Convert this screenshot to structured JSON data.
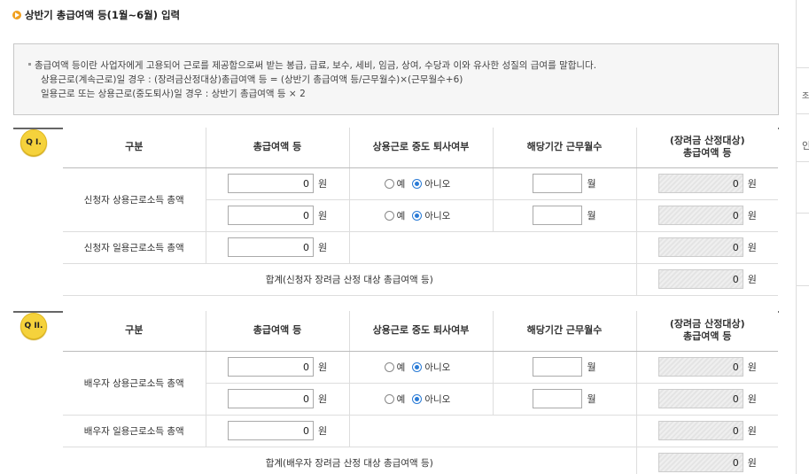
{
  "page": {
    "title": "상반기 총급여액 등(1월~6월) 입력"
  },
  "info": {
    "lines": [
      "총급여액 등이란 사업자에게 고용되어 근로를 제공함으로써 받는 봉급, 급료, 보수, 세비, 임금, 상여, 수당과 이와 유사한 성질의 급여를 말합니다.",
      "상용근로(계속근로)일 경우 : (장려금산정대상)총급여액 등 = (상반기 총급여액 등/근무월수)×(근무월수+6)",
      "일용근로 또는 상용근로(중도퇴사)일 경우 : 상반기 총급여액 등 × 2"
    ]
  },
  "columns": {
    "category": "구분",
    "total_pay": "총급여액 등",
    "resign": "상용근로 중도 퇴사여부",
    "months": "해당기간 근무월수",
    "calc_line1": "(장려금 산정대상)",
    "calc_line2": "총급여액 등"
  },
  "units": {
    "won": "원",
    "month": "월"
  },
  "radio": {
    "yes": "예",
    "no": "아니오"
  },
  "section1": {
    "badge": "Q I.",
    "regular_label": "신청자 상용근로소득 총액",
    "daily_label": "신청자 일용근로소득 총액",
    "sum_label": "합계(신청자 장려금 산정 대상 총급여액 등)",
    "row1": {
      "amount": "0",
      "calc": "0"
    },
    "row2": {
      "amount": "0",
      "calc": "0"
    },
    "daily": {
      "amount": "0",
      "calc": "0"
    },
    "sum": "0"
  },
  "section2": {
    "badge": "Q II.",
    "regular_label": "배우자 상용근로소득 총액",
    "daily_label": "배우자 일용근로소득 총액",
    "sum_label": "합계(배우자 장려금 산정 대상 총급여액 등)",
    "row1": {
      "amount": "0",
      "calc": "0"
    },
    "row2": {
      "amount": "0",
      "calc": "0"
    },
    "daily": {
      "amount": "0",
      "calc": "0"
    },
    "sum": "0"
  },
  "sidebar": {
    "frag1": "조",
    "frag2": "인"
  },
  "colors": {
    "badge": "#f5d23c",
    "radio_selected": "#2a7bd6",
    "title_bullet": "#f0a020"
  }
}
